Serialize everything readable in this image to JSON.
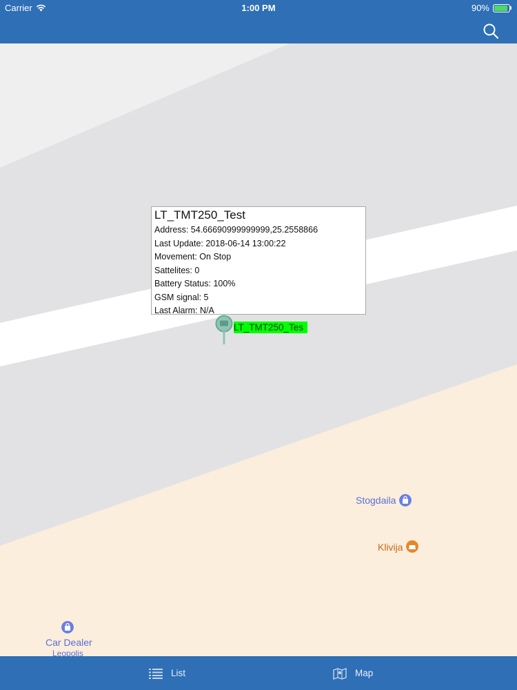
{
  "status_bar": {
    "carrier": "Carrier",
    "time": "1:00 PM",
    "battery_percent": "90%",
    "battery_level": 0.9
  },
  "header": {
    "search_icon": "search-icon"
  },
  "map": {
    "colors": {
      "background": "#e2e2e4",
      "road": "#ffffff",
      "land": "#fbeedd",
      "header": "#2e6fb6",
      "marker_label_bg": "#00ff00"
    },
    "popup": {
      "title": "LT_TMT250_Test",
      "address": "Address: 54.66690999999999,25.2558866",
      "last_update": "Last Update: 2018-06-14 13:00:22",
      "movement": "Movement: On Stop",
      "satellites": "Sattelites: 0",
      "battery_status": "Battery Status: 100%",
      "gsm_signal": "GSM signal: 5",
      "last_alarm": "Last Alarm: N/A"
    },
    "marker": {
      "label": "LT_TMT250_Tes",
      "icon": "map-pin-icon"
    },
    "pois": {
      "stogdaila": {
        "name": "Stogdaila",
        "icon": "shopping-bag-icon",
        "color": "#6a7fe0"
      },
      "klivija": {
        "name": "Klivija",
        "icon": "sofa-icon",
        "color": "#e6862a"
      },
      "car_dealer": {
        "name": "Car Dealer",
        "subname": "Leopolis",
        "icon": "shopping-bag-icon",
        "color": "#6a7fe0"
      }
    }
  },
  "tabs": {
    "list": {
      "label": "List",
      "icon": "list-icon"
    },
    "map": {
      "label": "Map",
      "icon": "map-icon"
    }
  }
}
